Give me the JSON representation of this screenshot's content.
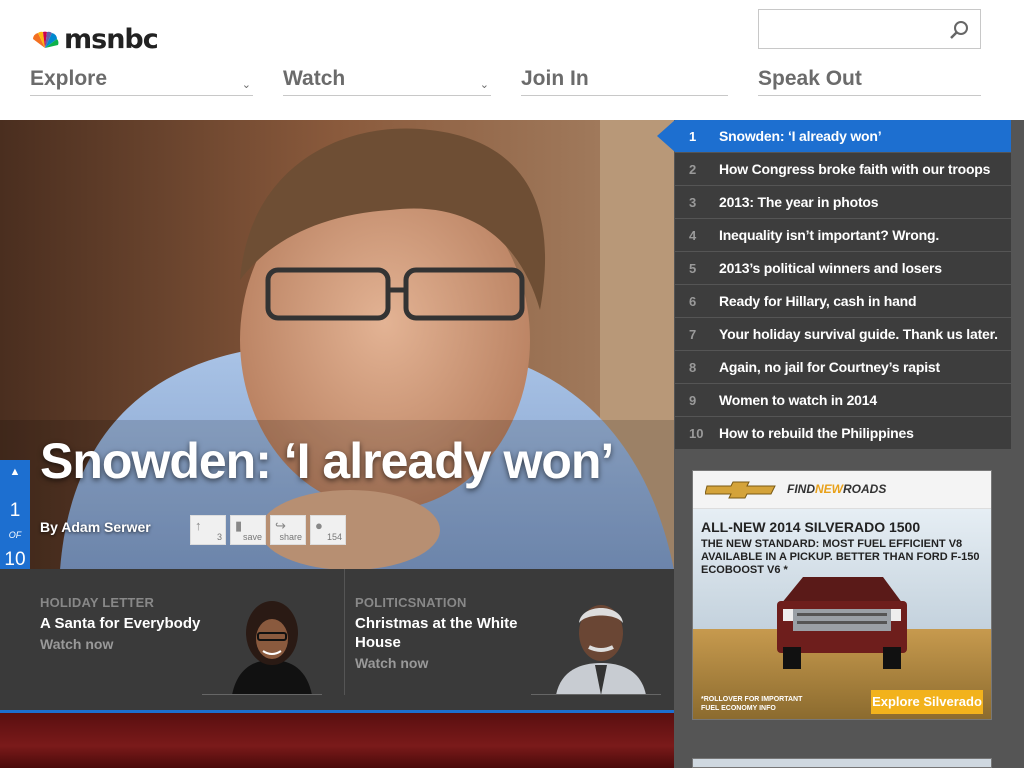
{
  "brand": {
    "name": "msnbc"
  },
  "search": {
    "placeholder": "",
    "value": ""
  },
  "nav": {
    "explore": "Explore",
    "watch": "Watch",
    "join_in": "Join In",
    "speak_out": "Speak Out"
  },
  "hero": {
    "title": "Snowden: ‘I already won’",
    "byline": "By Adam Serwer",
    "social": [
      {
        "icon": "↑",
        "label": "3"
      },
      {
        "icon": "▮",
        "label": "save"
      },
      {
        "icon": "↪",
        "label": "share"
      },
      {
        "icon": "●",
        "label": "154"
      }
    ],
    "pager": {
      "current": "1",
      "of": "OF",
      "total": "10"
    }
  },
  "promos": [
    {
      "kicker": "HOLIDAY LETTER",
      "title": "A Santa for Everybody",
      "watch": "Watch now"
    },
    {
      "kicker": "POLITICSNATION",
      "title_line1": "Christmas at the White",
      "title_line2": "House",
      "watch": "Watch now"
    }
  ],
  "top_ten": [
    {
      "num": "1",
      "title": "Snowden: ‘I already won’"
    },
    {
      "num": "2",
      "title": "How Congress broke faith with our troops"
    },
    {
      "num": "3",
      "title": "2013: The year in photos"
    },
    {
      "num": "4",
      "title": "Inequality isn’t important? Wrong."
    },
    {
      "num": "5",
      "title": "2013’s political winners and losers"
    },
    {
      "num": "6",
      "title": "Ready for Hillary, cash in hand"
    },
    {
      "num": "7",
      "title": "Your holiday survival guide. Thank us later."
    },
    {
      "num": "8",
      "title": "Again, no jail for Courtney’s rapist"
    },
    {
      "num": "9",
      "title": "Women to watch in 2014"
    },
    {
      "num": "10",
      "title": "How to rebuild the Philippines"
    }
  ],
  "ad": {
    "find": "FIND",
    "new": "NEW",
    "roads": "ROADS",
    "headline": "ALL-NEW 2014 SILVERADO 1500",
    "sub": "THE NEW STANDARD: MOST FUEL EFFICIENT V8 AVAILABLE IN A PICKUP. BETTER THAN FORD F-150 ECOBOOST V6 *",
    "foot_line1": "*ROLLOVER FOR IMPORTANT",
    "foot_line2": "FUEL ECONOMY INFO",
    "cta": "Explore Silverado"
  },
  "colors": {
    "accent": "#1d6fd0",
    "dark": "#3d3d3d",
    "ad_cta": "#f2b21c"
  }
}
